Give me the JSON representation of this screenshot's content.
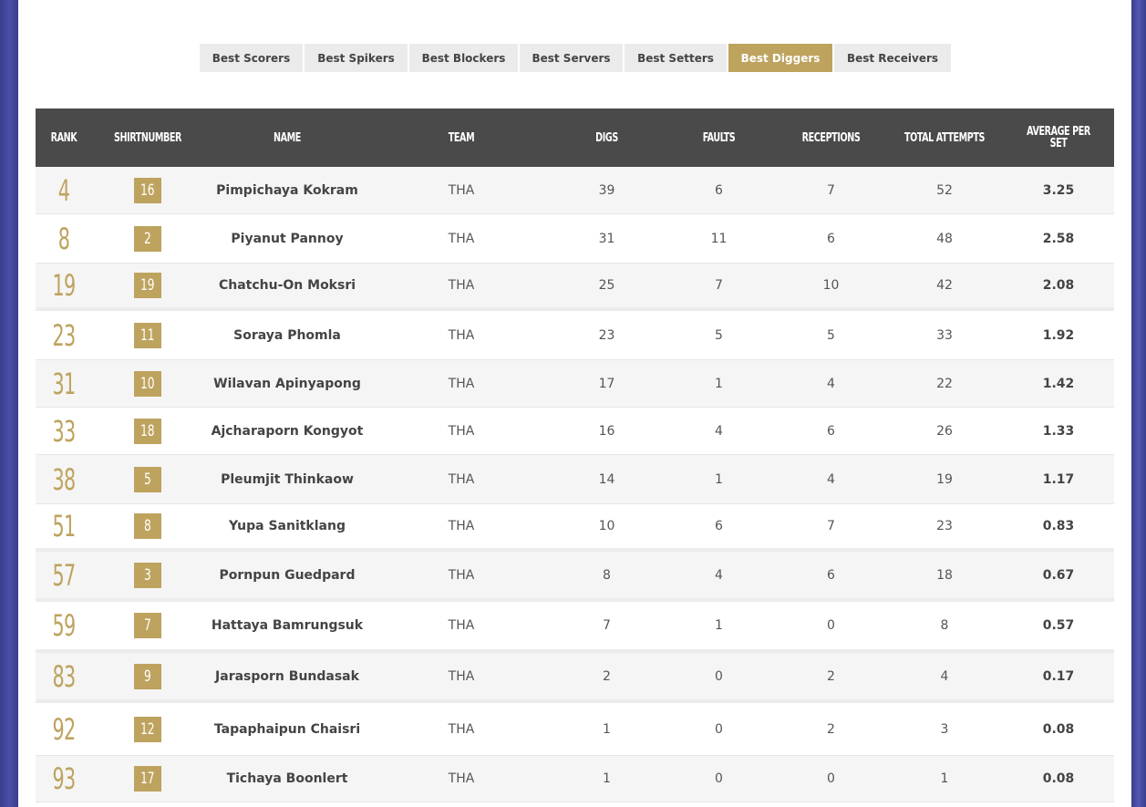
{
  "tabs": [
    {
      "label": "Best Scorers",
      "active": false
    },
    {
      "label": "Best Spikers",
      "active": false
    },
    {
      "label": "Best Blockers",
      "active": false
    },
    {
      "label": "Best Servers",
      "active": false
    },
    {
      "label": "Best Setters",
      "active": false
    },
    {
      "label": "Best Diggers",
      "active": true
    },
    {
      "label": "Best Receivers",
      "active": false
    }
  ],
  "headers": {
    "rank": "RANK",
    "shirt": "SHIRTNUMBER",
    "name": "NAME",
    "team": "TEAM",
    "digs": "DIGS",
    "faults": "FAULTS",
    "receptions": "RECEPTIONS",
    "total": "TOTAL ATTEMPTS",
    "avg": "AVERAGE PER SET"
  },
  "rows": [
    {
      "rank": "4",
      "shirt": "16",
      "name": "Pimpichaya Kokram",
      "team": "THA",
      "digs": "39",
      "faults": "6",
      "receptions": "7",
      "total": "52",
      "avg": "3.25"
    },
    {
      "rank": "8",
      "shirt": "2",
      "name": "Piyanut Pannoy",
      "team": "THA",
      "digs": "31",
      "faults": "11",
      "receptions": "6",
      "total": "48",
      "avg": "2.58"
    },
    {
      "rank": "19",
      "shirt": "19",
      "name": "Chatchu-On Moksri",
      "team": "THA",
      "digs": "25",
      "faults": "7",
      "receptions": "10",
      "total": "42",
      "avg": "2.08"
    },
    {
      "rank": "23",
      "shirt": "11",
      "name": "Soraya Phomla",
      "team": "THA",
      "digs": "23",
      "faults": "5",
      "receptions": "5",
      "total": "33",
      "avg": "1.92"
    },
    {
      "rank": "31",
      "shirt": "10",
      "name": "Wilavan Apinyapong",
      "team": "THA",
      "digs": "17",
      "faults": "1",
      "receptions": "4",
      "total": "22",
      "avg": "1.42"
    },
    {
      "rank": "33",
      "shirt": "18",
      "name": "Ajcharaporn Kongyot",
      "team": "THA",
      "digs": "16",
      "faults": "4",
      "receptions": "6",
      "total": "26",
      "avg": "1.33"
    },
    {
      "rank": "38",
      "shirt": "5",
      "name": "Pleumjit Thinkaow",
      "team": "THA",
      "digs": "14",
      "faults": "1",
      "receptions": "4",
      "total": "19",
      "avg": "1.17"
    },
    {
      "rank": "51",
      "shirt": "8",
      "name": "Yupa Sanitklang",
      "team": "THA",
      "digs": "10",
      "faults": "6",
      "receptions": "7",
      "total": "23",
      "avg": "0.83"
    },
    {
      "rank": "57",
      "shirt": "3",
      "name": "Pornpun Guedpard",
      "team": "THA",
      "digs": "8",
      "faults": "4",
      "receptions": "6",
      "total": "18",
      "avg": "0.67"
    },
    {
      "rank": "59",
      "shirt": "7",
      "name": "Hattaya Bamrungsuk",
      "team": "THA",
      "digs": "7",
      "faults": "1",
      "receptions": "0",
      "total": "8",
      "avg": "0.57"
    },
    {
      "rank": "83",
      "shirt": "9",
      "name": "Jarasporn Bundasak",
      "team": "THA",
      "digs": "2",
      "faults": "0",
      "receptions": "2",
      "total": "4",
      "avg": "0.17"
    },
    {
      "rank": "92",
      "shirt": "12",
      "name": "Tapaphaipun Chaisri",
      "team": "THA",
      "digs": "1",
      "faults": "0",
      "receptions": "2",
      "total": "3",
      "avg": "0.08"
    },
    {
      "rank": "93",
      "shirt": "17",
      "name": "Tichaya Boonlert",
      "team": "THA",
      "digs": "1",
      "faults": "0",
      "receptions": "0",
      "total": "1",
      "avg": "0.08"
    }
  ],
  "colors": {
    "accent": "#bea35f",
    "header_bg": "#4a4a4a",
    "tab_bg": "#ebebeb",
    "background": "#3a3f8f"
  }
}
